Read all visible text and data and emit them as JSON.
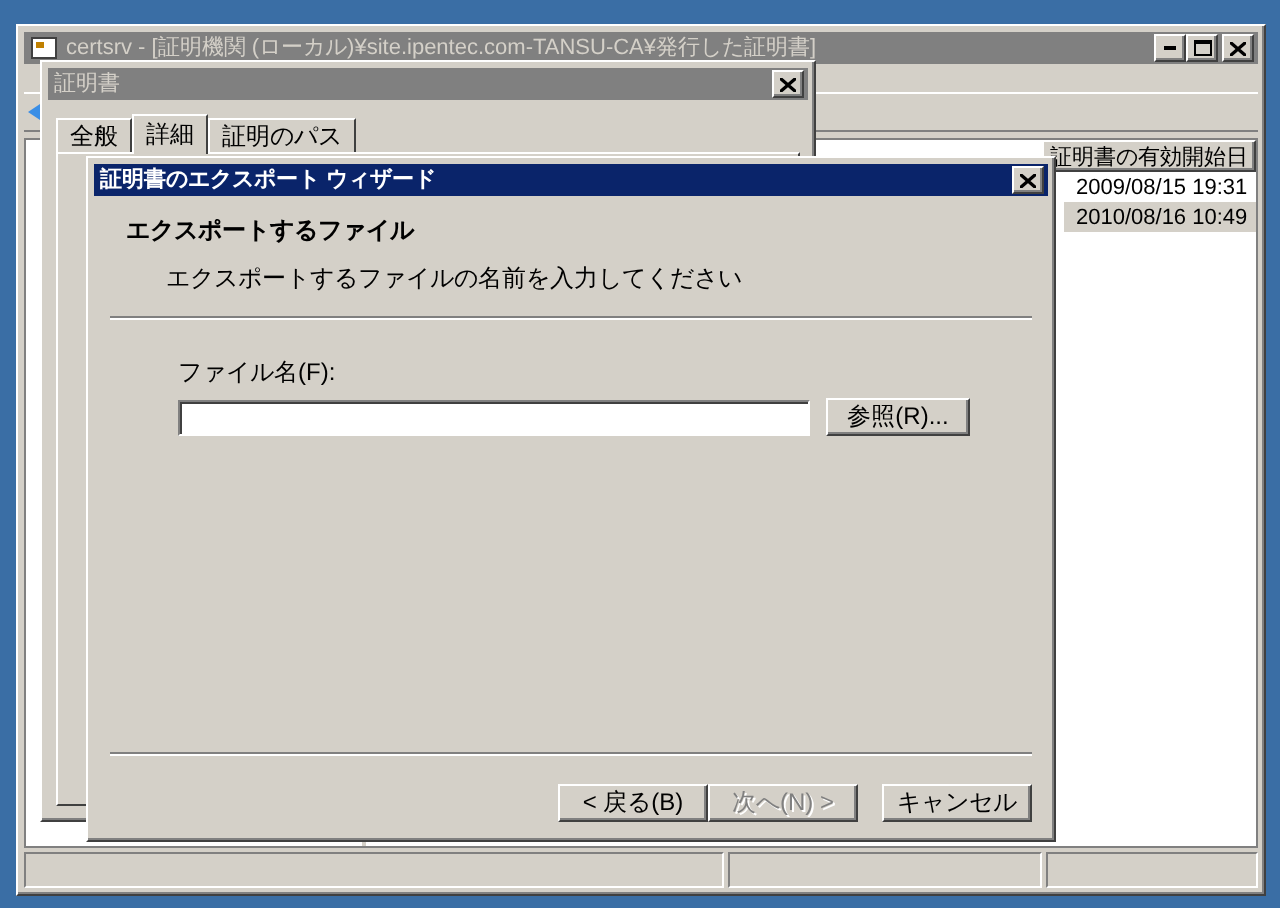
{
  "main_window": {
    "title": "certsrv - [証明機関 (ローカル)¥site.ipentec.com-TANSU-CA¥発行した証明書]",
    "list": {
      "columns": [
        {
          "label": "証明書の有効開始日"
        }
      ],
      "rows": [
        {
          "cells": [
            "2009/08/15 19:31"
          ],
          "selected": false
        },
        {
          "cells": [
            "2010/08/16 10:49"
          ],
          "selected": true
        }
      ]
    }
  },
  "certificate_dialog": {
    "title": "証明書",
    "tabs": [
      {
        "label": "全般",
        "selected": false
      },
      {
        "label": "詳細",
        "selected": true
      },
      {
        "label": "証明のパス",
        "selected": false
      }
    ]
  },
  "wizard": {
    "title": "証明書のエクスポート ウィザード",
    "heading": "エクスポートするファイル",
    "description": "エクスポートするファイルの名前を入力してください",
    "file_name": {
      "label": "ファイル名(F):"
    },
    "browse_button": "参照(R)...",
    "buttons": [
      {
        "label": "< 戻る(B)",
        "disabled": false
      },
      {
        "label": "次へ(N) >",
        "disabled": true
      },
      {
        "label": "キャンセル",
        "disabled": false
      }
    ]
  }
}
